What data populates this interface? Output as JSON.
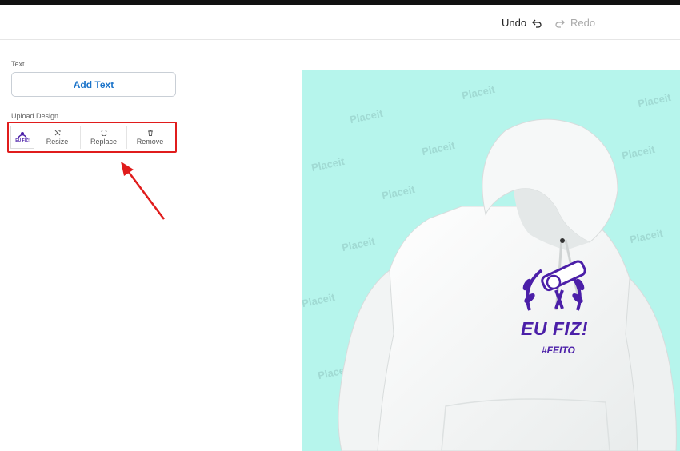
{
  "header": {
    "undo_label": "Undo",
    "redo_label": "Redo"
  },
  "sidebar": {
    "text_section_label": "Text",
    "add_text_label": "Add Text",
    "upload_section_label": "Upload Design",
    "design_thumb_text": "EU FIZ!",
    "tools": [
      {
        "label": "Resize",
        "icon": "resize-icon"
      },
      {
        "label": "Replace",
        "icon": "replace-icon"
      },
      {
        "label": "Remove",
        "icon": "trash-icon"
      }
    ]
  },
  "canvas": {
    "watermark": "Placeit",
    "design_title": "EU FIZ!",
    "design_subtitle": "#FEITO",
    "colors": {
      "background": "#b6f5ec",
      "design": "#4b1fa8",
      "hoodie": "#ffffff"
    }
  },
  "annotation": {
    "highlight_color": "#e01c1c"
  }
}
